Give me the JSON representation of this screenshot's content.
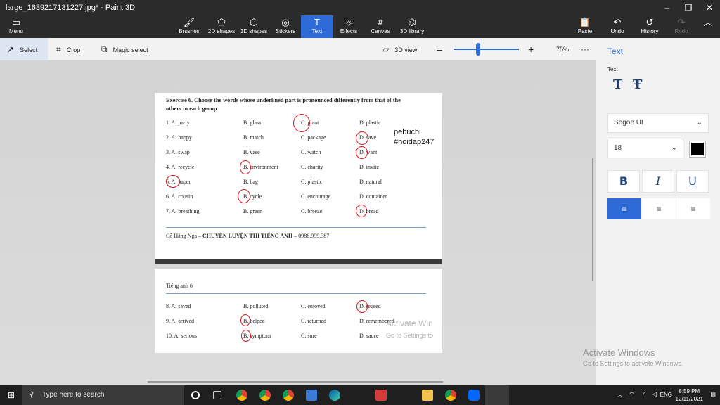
{
  "window": {
    "title": "large_1639217131227.jpg* - Paint 3D"
  },
  "ribbon": {
    "menu": "Menu",
    "tools": [
      {
        "label": "Brushes",
        "icon": "brush-icon"
      },
      {
        "label": "2D shapes",
        "icon": "shapes-2d-icon"
      },
      {
        "label": "3D shapes",
        "icon": "shapes-3d-icon"
      },
      {
        "label": "Stickers",
        "icon": "sticker-icon"
      },
      {
        "label": "Text",
        "icon": "text-icon"
      },
      {
        "label": "Effects",
        "icon": "effects-icon"
      },
      {
        "label": "Canvas",
        "icon": "canvas-icon"
      },
      {
        "label": "3D library",
        "icon": "library-icon"
      }
    ],
    "actions": {
      "paste": "Paste",
      "undo": "Undo",
      "history": "History",
      "redo": "Redo"
    }
  },
  "toolbar": {
    "select": "Select",
    "crop": "Crop",
    "magic_select": "Magic select",
    "view3d": "3D view",
    "zoom": "75%"
  },
  "document": {
    "heading": "Exercise 6. Choose the words whose underlined part is pronounced differently from that of the others in each group",
    "rows1": [
      [
        "1. A. party",
        "B. glass",
        "C. plant",
        "D. plastic"
      ],
      [
        "2. A. happy",
        "B. match",
        "C. package",
        "D. save"
      ],
      [
        "3. A. swap",
        "B. vase",
        "C. watch",
        "D. want"
      ],
      [
        "4. A. recycle",
        "B. environment",
        "C. charity",
        "D. invite"
      ],
      [
        "5. A. paper",
        "B. bag",
        "C. plastic",
        "D. natural"
      ],
      [
        "6. A. cousin",
        "B. cycle",
        "C. encourage",
        "D. container"
      ],
      [
        "7. A. breathing",
        "B. green",
        "C. breeze",
        "D. bread"
      ]
    ],
    "footer_name": "Cô Hằng Nga – ",
    "footer_course": "CHUYÊN LUYỆN THI TIẾNG ANH",
    "footer_phone": " – 0988.999.387",
    "subheading": "Tiếng anh 6",
    "rows2": [
      [
        "8. A. saved",
        "B. polluted",
        "C. enjoyed",
        "D. reused"
      ],
      [
        "9. A. arrived",
        "B. helped",
        "C. returned",
        "D. remembered"
      ],
      [
        "10. A. serious",
        "B. symptom",
        "C. sure",
        "D. sauce"
      ]
    ],
    "annotation_line1": "pebuchi",
    "annotation_line2": "#hoidap247",
    "circle_color": "#d8141b"
  },
  "watermark": {
    "inner_line1": "Activate Win",
    "inner_line2": "Go to Settings to",
    "outer_line1": "Activate Windows",
    "outer_line2": "Go to Settings to activate Windows."
  },
  "panel": {
    "title": "Text",
    "label": "Text",
    "font": "Segoe UI",
    "size": "18",
    "color": "#000000",
    "accent": "#2e6bd6"
  },
  "taskbar": {
    "search_placeholder": "Type here to search",
    "lang": "ENG",
    "time": "8:59 PM",
    "date": "12/11/2021"
  }
}
